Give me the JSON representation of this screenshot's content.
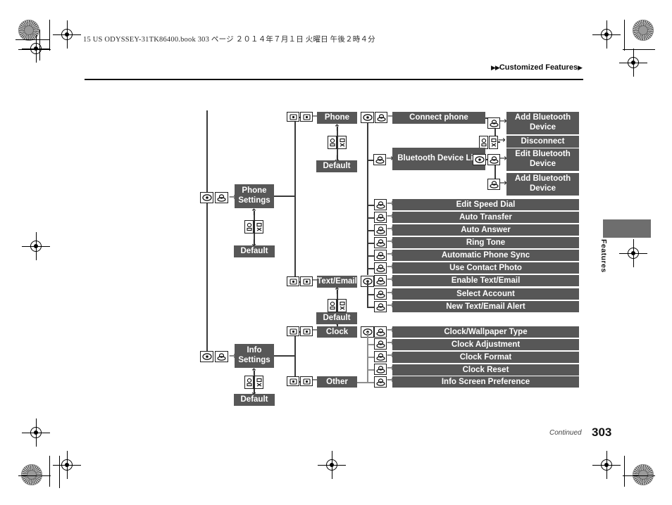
{
  "page": {
    "book_line": "15 US ODYSSEY-31TK86400.book   303 ページ   ２０１４年７月１日   火曜日   午後２時４分",
    "running_head": "Customized Features",
    "running_head_marker_left": "▶▶",
    "running_head_marker_right": "▶",
    "side_tab_label": "Features",
    "continued_label": "Continued",
    "page_number": "303"
  },
  "colors": {
    "node_fill": "#575757",
    "node_text": "#ffffff",
    "line": "#3a3a3a",
    "tab_fill": "#6e6e6e"
  },
  "chart_data": {
    "type": "diagram",
    "title": "Customized Features menu tree",
    "roots": [
      {
        "label": "Phone Settings",
        "default_label": "Default",
        "branches": [
          {
            "label": "Phone",
            "default_label": "Default",
            "items": [
              {
                "label": "Connect phone",
                "children": [
                  "Add Bluetooth Device",
                  "Disconnect"
                ]
              },
              {
                "label": "Bluetooth Device List",
                "children": [
                  "Edit Bluetooth Device",
                  "Add Bluetooth Device"
                ]
              },
              {
                "label": "Edit Speed Dial",
                "children": []
              },
              {
                "label": "Auto Transfer",
                "children": []
              },
              {
                "label": "Auto Answer",
                "children": []
              },
              {
                "label": "Ring Tone",
                "children": []
              },
              {
                "label": "Automatic Phone Sync",
                "children": []
              },
              {
                "label": "Use Contact Photo",
                "children": []
              }
            ]
          },
          {
            "label": "Text/Email",
            "default_label": "Default",
            "items": [
              {
                "label": "Enable Text/Email",
                "children": []
              },
              {
                "label": "Select Account",
                "children": []
              },
              {
                "label": "New Text/Email Alert",
                "children": []
              }
            ]
          }
        ]
      },
      {
        "label": "Info Settings",
        "default_label": "Default",
        "branches": [
          {
            "label": "Clock",
            "items": [
              {
                "label": "Clock/Wallpaper Type",
                "children": []
              },
              {
                "label": "Clock Adjustment",
                "children": []
              },
              {
                "label": "Clock Format",
                "children": []
              },
              {
                "label": "Clock Reset",
                "children": []
              }
            ]
          },
          {
            "label": "Other",
            "items": [
              {
                "label": "Info Screen Preference",
                "children": []
              }
            ]
          }
        ]
      }
    ],
    "icons": {
      "phone_knob": "phone-button-icon",
      "enter_knob": "enter-knob-icon",
      "selector_left": "selector-left-icon",
      "selector_right": "selector-right-icon",
      "back_pair": "back-button-pair-icon"
    }
  },
  "nodes": {
    "phone_settings": "Phone Settings",
    "info_settings": "Info Settings",
    "phone": "Phone",
    "text_email": "Text/Email",
    "clock": "Clock",
    "other": "Other",
    "default_1": "Default",
    "default_2": "Default",
    "default_3": "Default",
    "default_4": "Default",
    "connect_phone": "Connect phone",
    "bluetooth_device_list": "Bluetooth Device List",
    "add_bluetooth_device_1": "Add Bluetooth Device",
    "disconnect": "Disconnect",
    "edit_bluetooth_device": "Edit Bluetooth Device",
    "add_bluetooth_device_2": "Add Bluetooth Device",
    "edit_speed_dial": "Edit Speed Dial",
    "auto_transfer": "Auto Transfer",
    "auto_answer": "Auto Answer",
    "ring_tone": "Ring Tone",
    "automatic_phone_sync": "Automatic Phone Sync",
    "use_contact_photo": "Use Contact Photo",
    "enable_text_email": "Enable Text/Email",
    "select_account": "Select Account",
    "new_text_email_alert": "New Text/Email Alert",
    "clock_wallpaper_type": "Clock/Wallpaper Type",
    "clock_adjustment": "Clock Adjustment",
    "clock_format": "Clock Format",
    "clock_reset": "Clock Reset",
    "info_screen_preference": "Info Screen Preference"
  }
}
